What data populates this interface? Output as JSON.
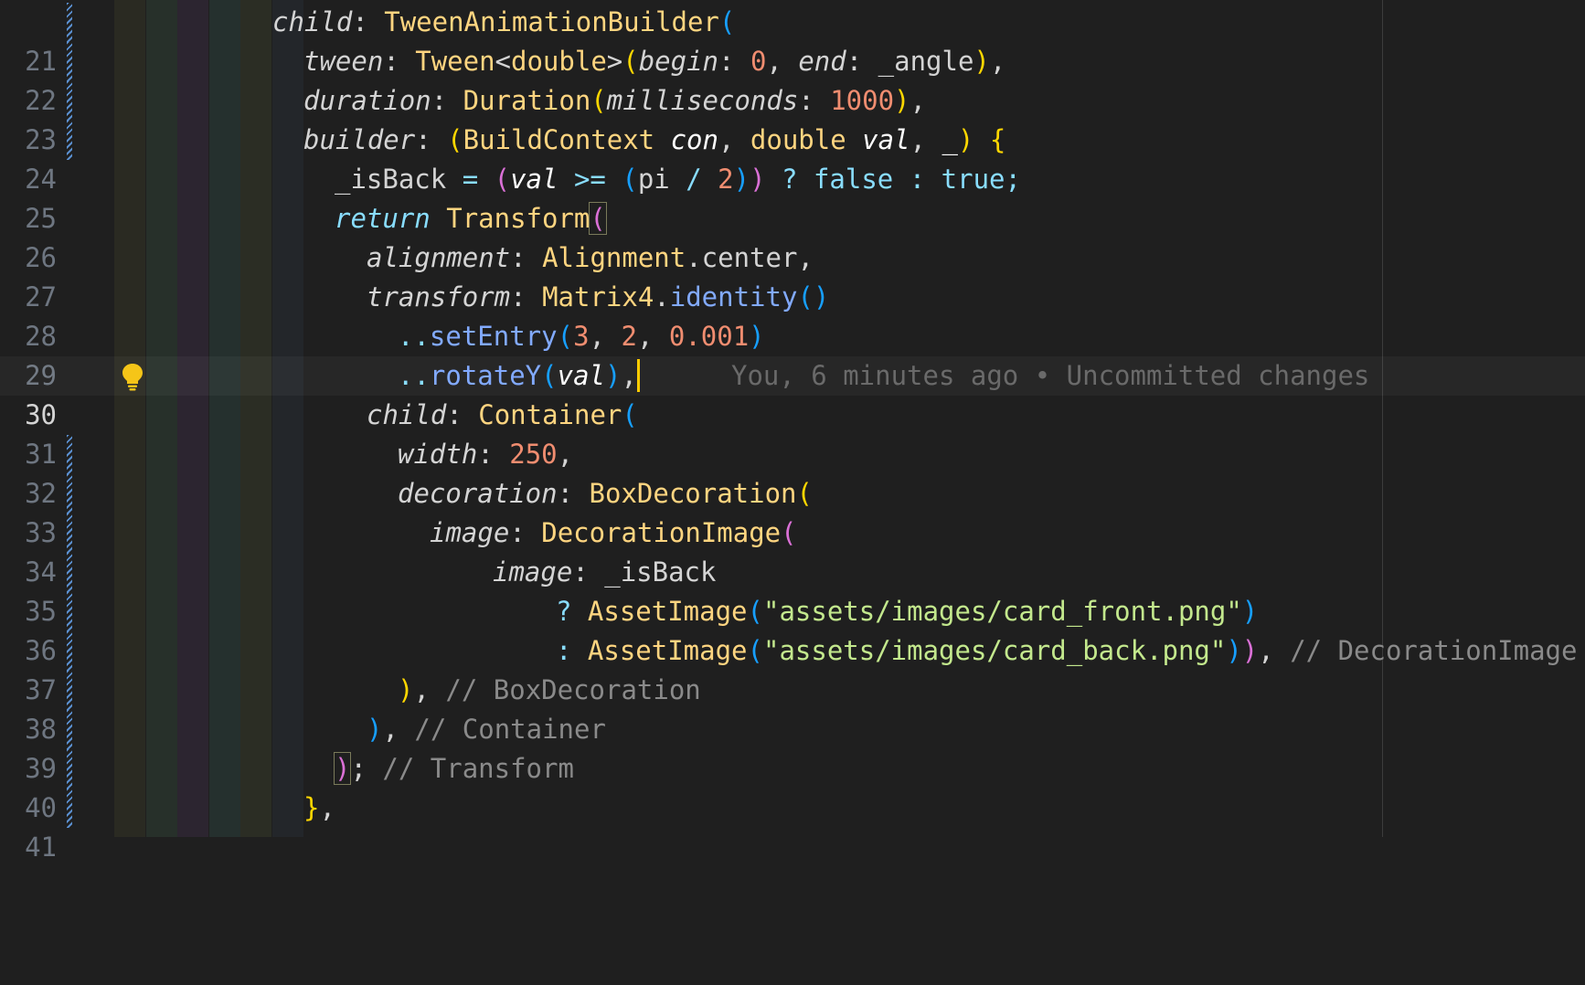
{
  "editor": {
    "blame_text": "You, 6 minutes ago • Uncommitted changes",
    "current_line": "30",
    "line_numbers": [
      "21",
      "22",
      "23",
      "24",
      "25",
      "26",
      "27",
      "28",
      "29",
      "30",
      "31",
      "32",
      "33",
      "34",
      "35",
      "36",
      "37",
      "38",
      "39",
      "40",
      "41"
    ],
    "lines": {
      "l21": [
        "child",
        ": ",
        "TweenAnimationBuilder",
        "("
      ],
      "l22": [
        "tween",
        ": ",
        "Tween",
        "<",
        "double",
        ">",
        "(",
        "begin",
        ": ",
        "0",
        ", ",
        "end",
        ": ",
        "_angle",
        ")",
        ","
      ],
      "l23": [
        "duration",
        ": ",
        "Duration",
        "(",
        "milliseconds",
        ": ",
        "1000",
        ")",
        ","
      ],
      "l24": [
        "builder",
        ": ",
        "(",
        "BuildContext",
        " ",
        "con",
        ", ",
        "double",
        " ",
        "val",
        ", ",
        "_",
        ")",
        " ",
        "{"
      ],
      "l25": [
        "_isBack",
        " ",
        "=",
        " ",
        "(",
        "val",
        " ",
        ">=",
        " ",
        "(",
        "pi",
        " ",
        "/",
        " ",
        "2",
        ")",
        ")",
        " ",
        "?",
        " ",
        "false",
        " ",
        ":",
        " ",
        "true",
        ";"
      ],
      "l26": [
        "return",
        " ",
        "Transform",
        "("
      ],
      "l27": [
        "alignment",
        ": ",
        "Alignment",
        ".",
        "center",
        ","
      ],
      "l28": [
        "transform",
        ": ",
        "Matrix4",
        ".",
        "identity",
        "(",
        ")"
      ],
      "l29": [
        "..",
        "setEntry",
        "(",
        "3",
        ", ",
        "2",
        ", ",
        "0.001",
        ")"
      ],
      "l30": [
        "..",
        "rotateY",
        "(",
        "val",
        ")",
        ","
      ],
      "l31": [
        "child",
        ": ",
        "Container",
        "("
      ],
      "l32": [
        "width",
        ": ",
        "250",
        ","
      ],
      "l33": [
        "decoration",
        ": ",
        "BoxDecoration",
        "("
      ],
      "l34": [
        "image",
        ": ",
        "DecorationImage",
        "("
      ],
      "l35": [
        "image",
        ": ",
        "_isBack"
      ],
      "l36": [
        "? ",
        "AssetImage",
        "(",
        "\"assets/images/card_front.png\"",
        ")"
      ],
      "l37": [
        ": ",
        "AssetImage",
        "(",
        "\"assets/images/card_back.png\"",
        ")",
        ")",
        ", ",
        "// DecorationImage"
      ],
      "l38": [
        ")",
        ", ",
        "// BoxDecoration"
      ],
      "l39": [
        ")",
        ", ",
        "// Container"
      ],
      "l40": [
        ")",
        "; ",
        "// Transform"
      ],
      "l41": [
        "}",
        ","
      ]
    }
  },
  "icons": {
    "lightbulb": "lightbulb-icon"
  },
  "colors": {
    "background": "#1f1f1f",
    "type": "#ffd580",
    "number": "#f08d70",
    "method": "#82aaff",
    "keyword": "#89ddff",
    "string": "#c3e88d",
    "comment": "#8a8a8a",
    "cursor": "#ffcc00"
  }
}
